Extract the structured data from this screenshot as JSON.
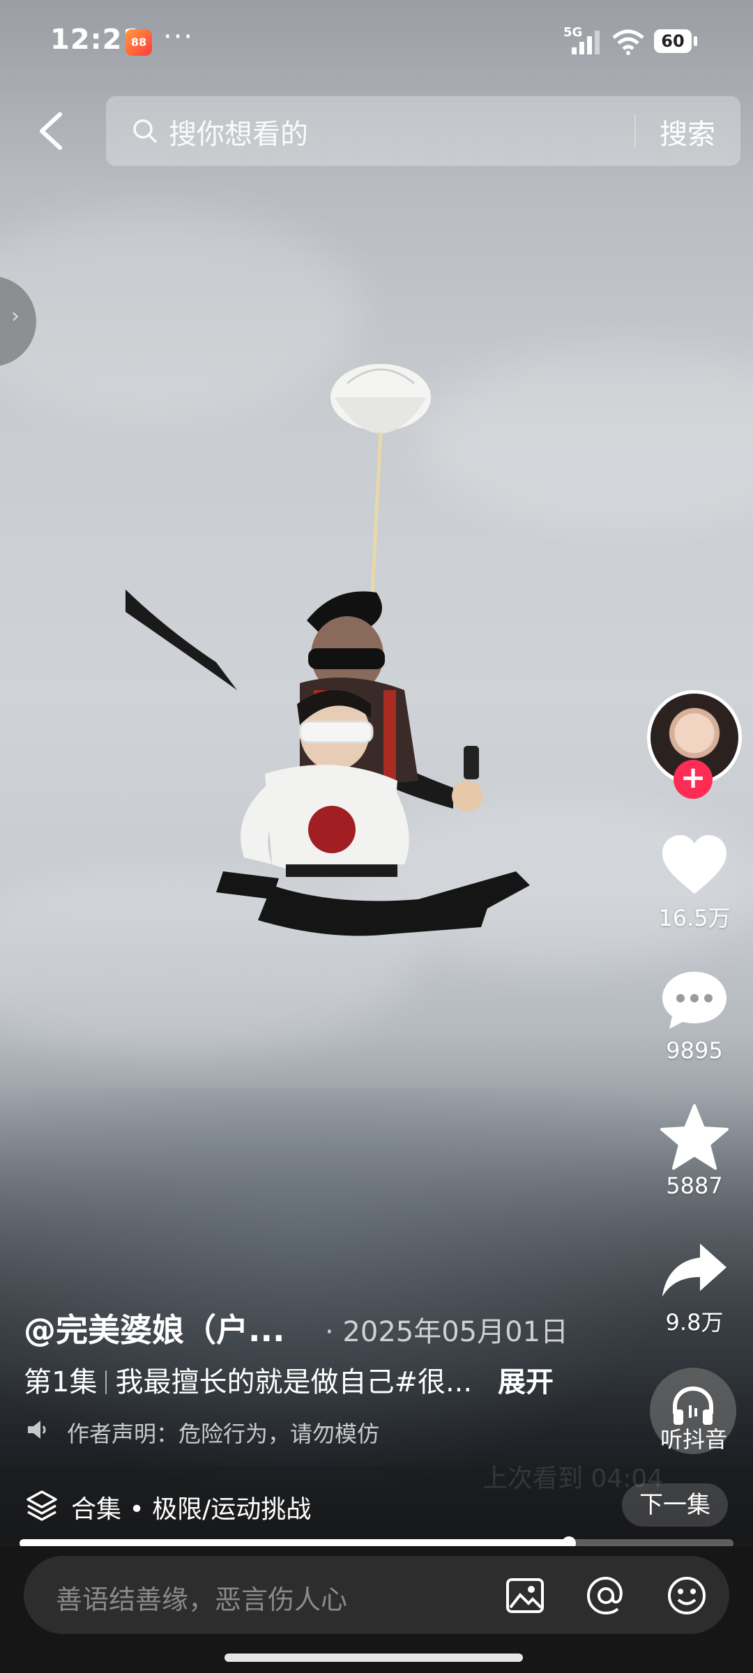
{
  "status_bar": {
    "time": "12:21",
    "network": "5G",
    "battery": "60"
  },
  "search": {
    "placeholder": "搜你想看的",
    "button": "搜索"
  },
  "actions": {
    "likes": "16.5万",
    "comments": "9895",
    "favorites": "5887",
    "shares": "9.8万",
    "listen": "听抖音"
  },
  "video": {
    "author": "@完美婆娘（户...",
    "date": "· 2025年05月01日",
    "episode": "第1集",
    "description": "我最擅长的就是做自己#很...",
    "expand": "展开",
    "disclaimer": "作者声明：危险行为，请勿模仿",
    "resume_hint": "上次看到 04:04",
    "progress": 0.77
  },
  "collection": {
    "label": "合集 • 极限/运动挑战",
    "next": "下一集"
  },
  "comment": {
    "placeholder": "善语结善缘，恶言伤人心"
  }
}
